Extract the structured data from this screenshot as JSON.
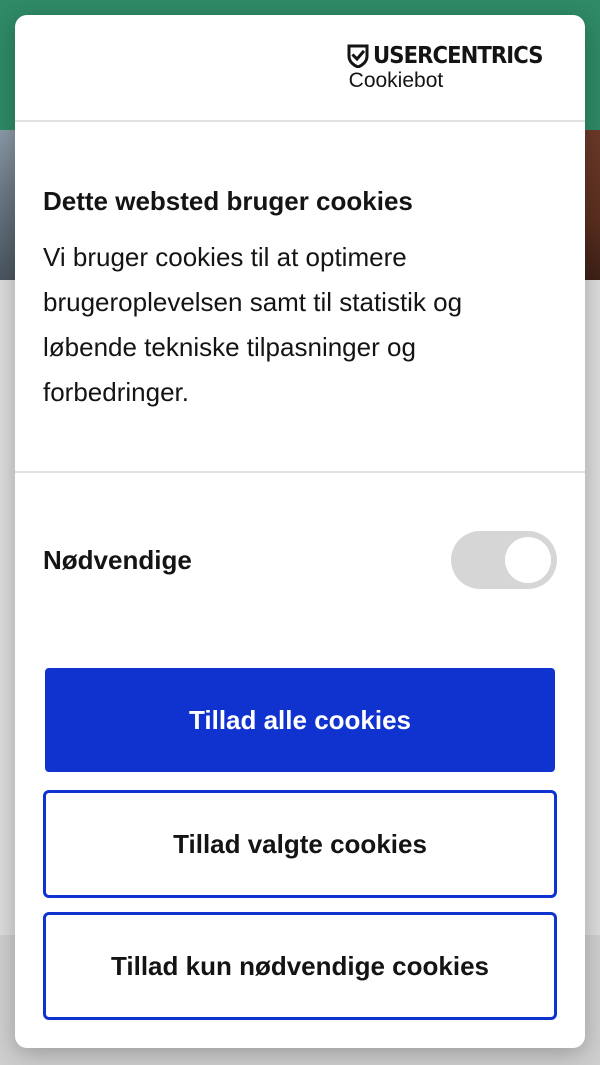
{
  "brand": {
    "name": "USERCENTRICS",
    "sub": "Cookiebot"
  },
  "dialog": {
    "title": "Dette websted bruger cookies",
    "body": "Vi bruger cookies til at optimere brugeroplevelsen samt til statistik og løbende tekniske tilpasninger og forbedringer."
  },
  "toggle": {
    "label": "Nødvendige",
    "state": "on-disabled"
  },
  "buttons": {
    "allow_all": "Tillad alle cookies",
    "allow_selected": "Tillad valgte cookies",
    "allow_necessary": "Tillad kun nødvendige cookies"
  },
  "colors": {
    "accent": "#1032cf",
    "page_header": "#2f8a66",
    "toggle_track": "#d6d6d6",
    "text": "#141414"
  }
}
